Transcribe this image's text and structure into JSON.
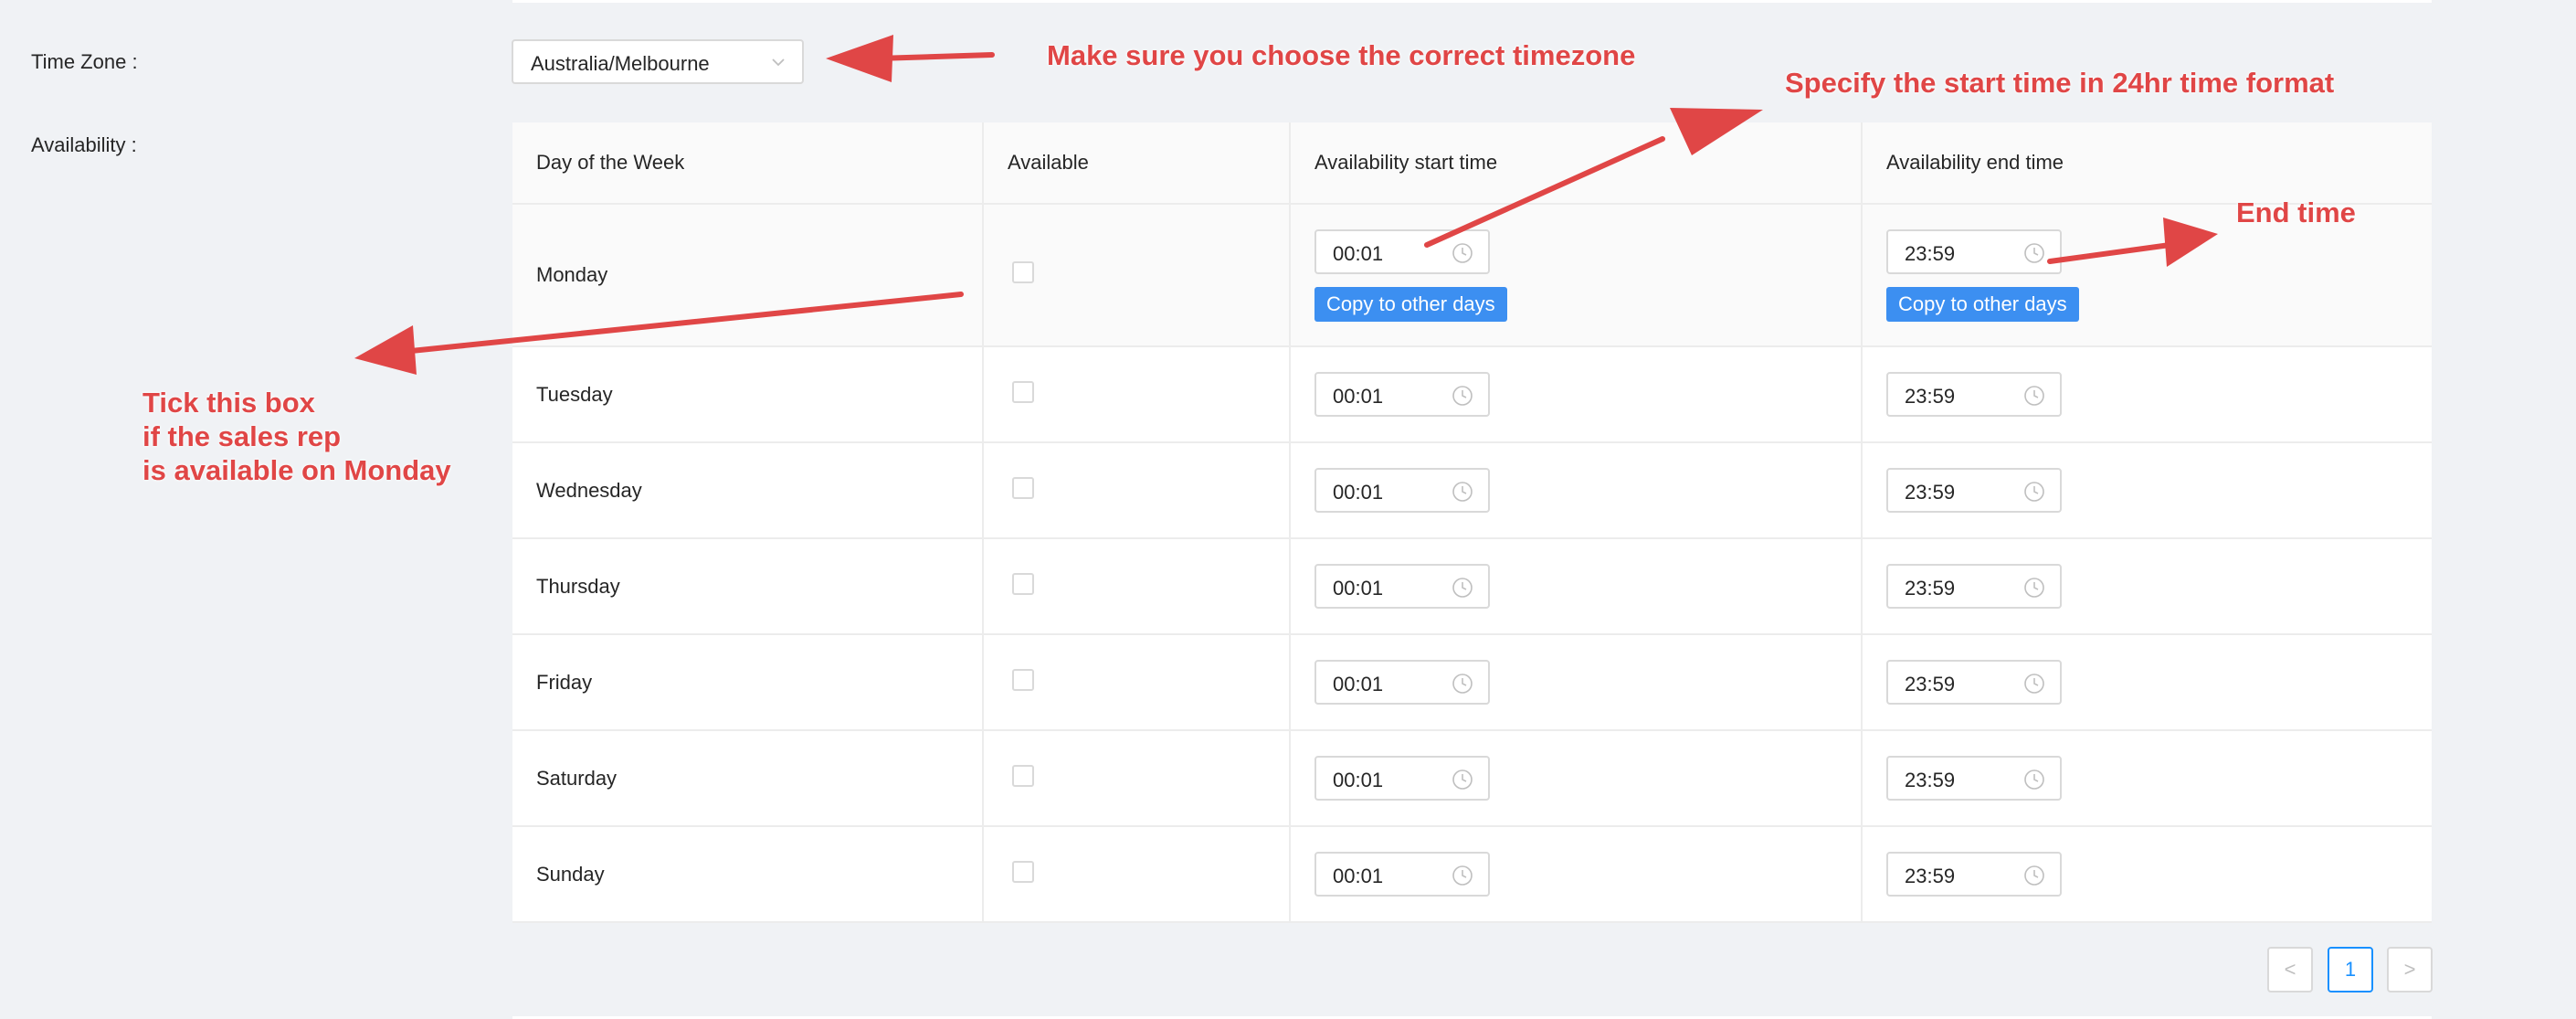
{
  "form": {
    "timezone_label": "Time Zone",
    "timezone_value": "Australia/Melbourne",
    "availability_label": "Availability"
  },
  "table": {
    "columns": [
      "Day of the Week",
      "Available",
      "Availability start time",
      "Availability end time"
    ],
    "rows": [
      {
        "day": "Monday",
        "available": false,
        "start": "00:01",
        "end": "23:59"
      },
      {
        "day": "Tuesday",
        "available": false,
        "start": "00:01",
        "end": "23:59"
      },
      {
        "day": "Wednesday",
        "available": false,
        "start": "00:01",
        "end": "23:59"
      },
      {
        "day": "Thursday",
        "available": false,
        "start": "00:01",
        "end": "23:59"
      },
      {
        "day": "Friday",
        "available": false,
        "start": "00:01",
        "end": "23:59"
      },
      {
        "day": "Saturday",
        "available": false,
        "start": "00:01",
        "end": "23:59"
      },
      {
        "day": "Sunday",
        "available": false,
        "start": "00:01",
        "end": "23:59"
      }
    ],
    "copy_label": "Copy to other days"
  },
  "pagination": {
    "prev": "<",
    "current": "1",
    "next": ">"
  },
  "annotations": {
    "timezone_note": "Make sure you choose the correct timezone",
    "start_note": "Specify the start time in 24hr time format",
    "end_note": "End time",
    "tick_note": [
      "Tick this box",
      "if the sales rep",
      "is available on Monday"
    ]
  },
  "colors": {
    "annotation": "#e04646",
    "button": "#3c8ff1",
    "pager_active": "#1890ff"
  },
  "icons": {
    "select_arrow": "chevron-down-icon",
    "time_input": "clock-icon"
  }
}
